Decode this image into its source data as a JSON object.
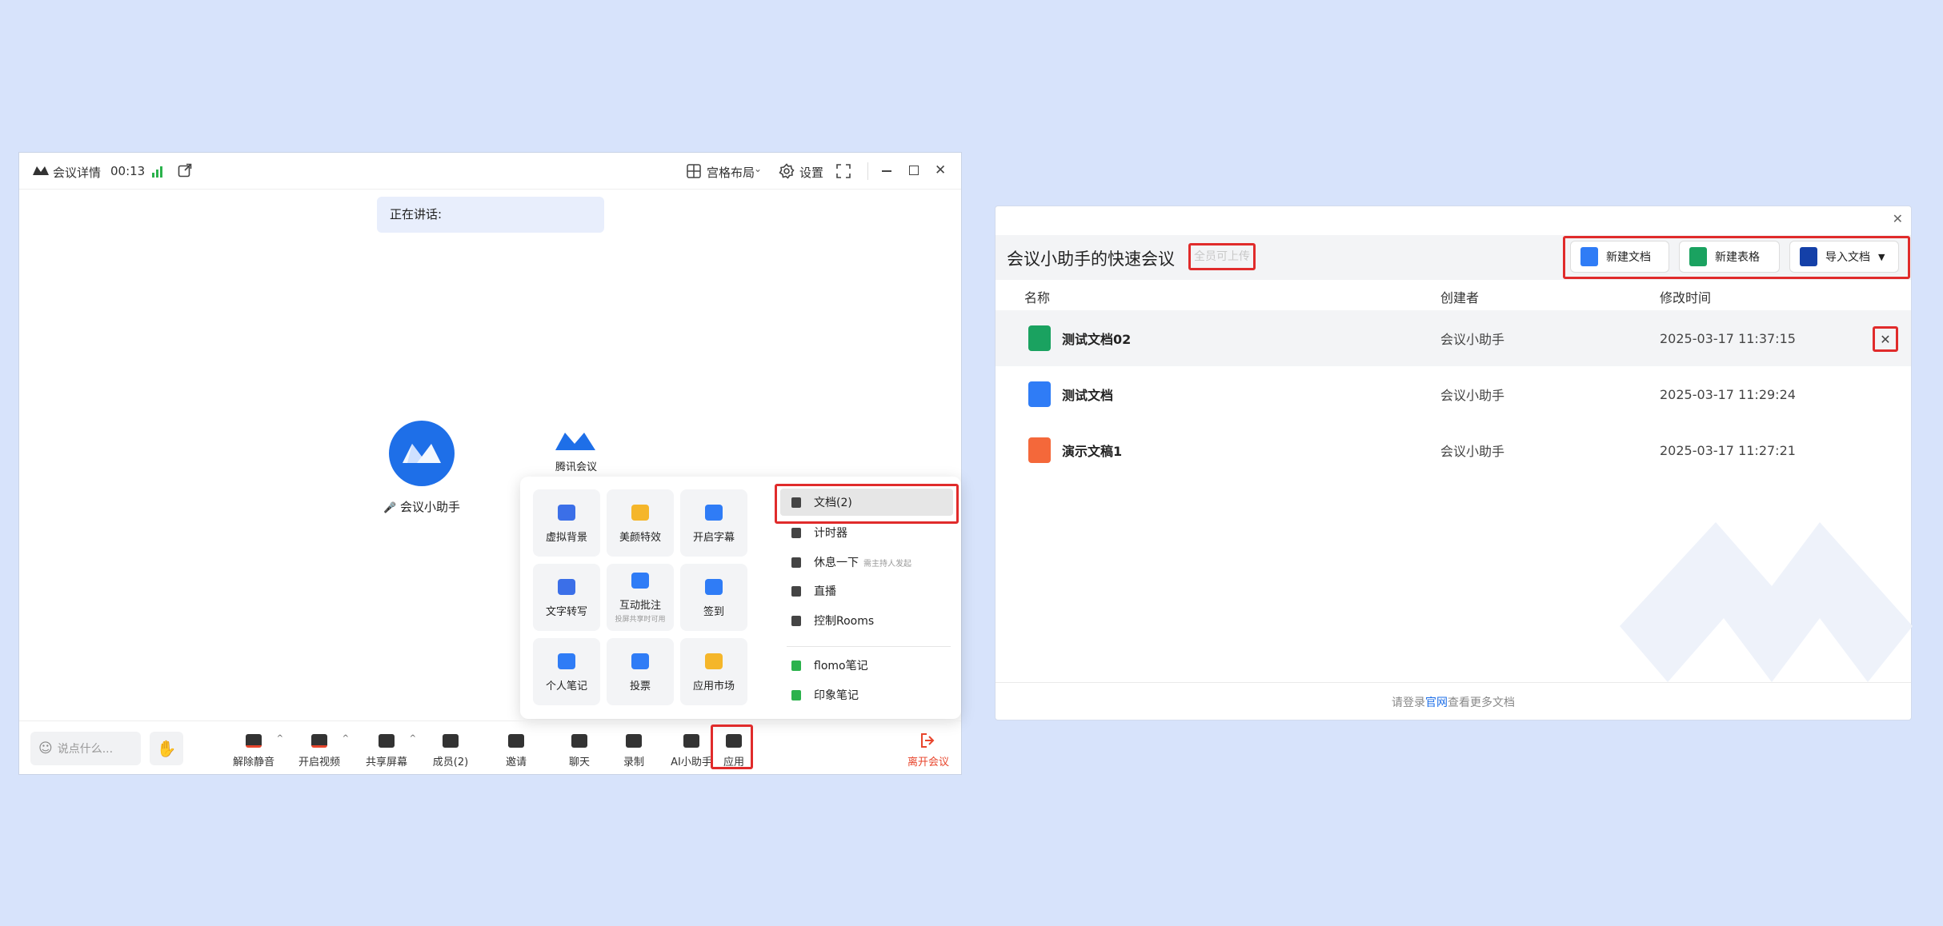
{
  "meeting": {
    "title_label": "会议详情",
    "timer": "00:13",
    "layout_label": "宫格布局",
    "settings_label": "设置",
    "speaking_label": "正在讲话:",
    "participant_name": "会议小助手",
    "app_logo_text": "腾讯会议",
    "apps_grid": [
      {
        "label": "虚拟背景",
        "sub": ""
      },
      {
        "label": "美颜特效",
        "sub": ""
      },
      {
        "label": "开启字幕",
        "sub": ""
      },
      {
        "label": "文字转写",
        "sub": ""
      },
      {
        "label": "互动批注",
        "sub": "投屏共享时可用"
      },
      {
        "label": "签到",
        "sub": ""
      },
      {
        "label": "个人笔记",
        "sub": ""
      },
      {
        "label": "投票",
        "sub": ""
      },
      {
        "label": "应用市场",
        "sub": ""
      }
    ],
    "apps_menu": [
      {
        "label": "文档(2)",
        "note": ""
      },
      {
        "label": "计时器",
        "note": ""
      },
      {
        "label": "休息一下",
        "note": "需主持人发起"
      },
      {
        "label": "直播",
        "note": ""
      },
      {
        "label": "控制Rooms",
        "note": ""
      },
      {
        "label": "flomo笔记",
        "note": ""
      },
      {
        "label": "印象笔记",
        "note": ""
      }
    ],
    "chat_placeholder": "说点什么...",
    "bottom": [
      "解除静音",
      "开启视频",
      "共享屏幕",
      "成员(2)",
      "邀请",
      "聊天",
      "录制",
      "AI小助手",
      "应用"
    ],
    "leave_label": "离开会议"
  },
  "docs": {
    "title": "会议小助手的快速会议",
    "upload_tag": "全员可上传",
    "new_doc": "新建文档",
    "new_sheet": "新建表格",
    "import_doc": "导入文档",
    "columns": [
      "名称",
      "创建者",
      "修改时间"
    ],
    "rows": [
      {
        "name": "测试文档02",
        "creator": "会议小助手",
        "time": "2025-03-17 11:37:15",
        "type": "sheet",
        "color": "#1aa260"
      },
      {
        "name": "测试文档",
        "creator": "会议小助手",
        "time": "2025-03-17 11:29:24",
        "type": "doc",
        "color": "#2f7cf6"
      },
      {
        "name": "演示文稿1",
        "creator": "会议小助手",
        "time": "2025-03-17 11:27:21",
        "type": "slide",
        "color": "#f4683a"
      }
    ],
    "footer_pre": "请登录",
    "footer_link": "官网",
    "footer_post": "查看更多文档"
  },
  "colors": {
    "accent": "#1e6fe8",
    "highlight": "#e02b2b",
    "leave": "#e8452c"
  }
}
